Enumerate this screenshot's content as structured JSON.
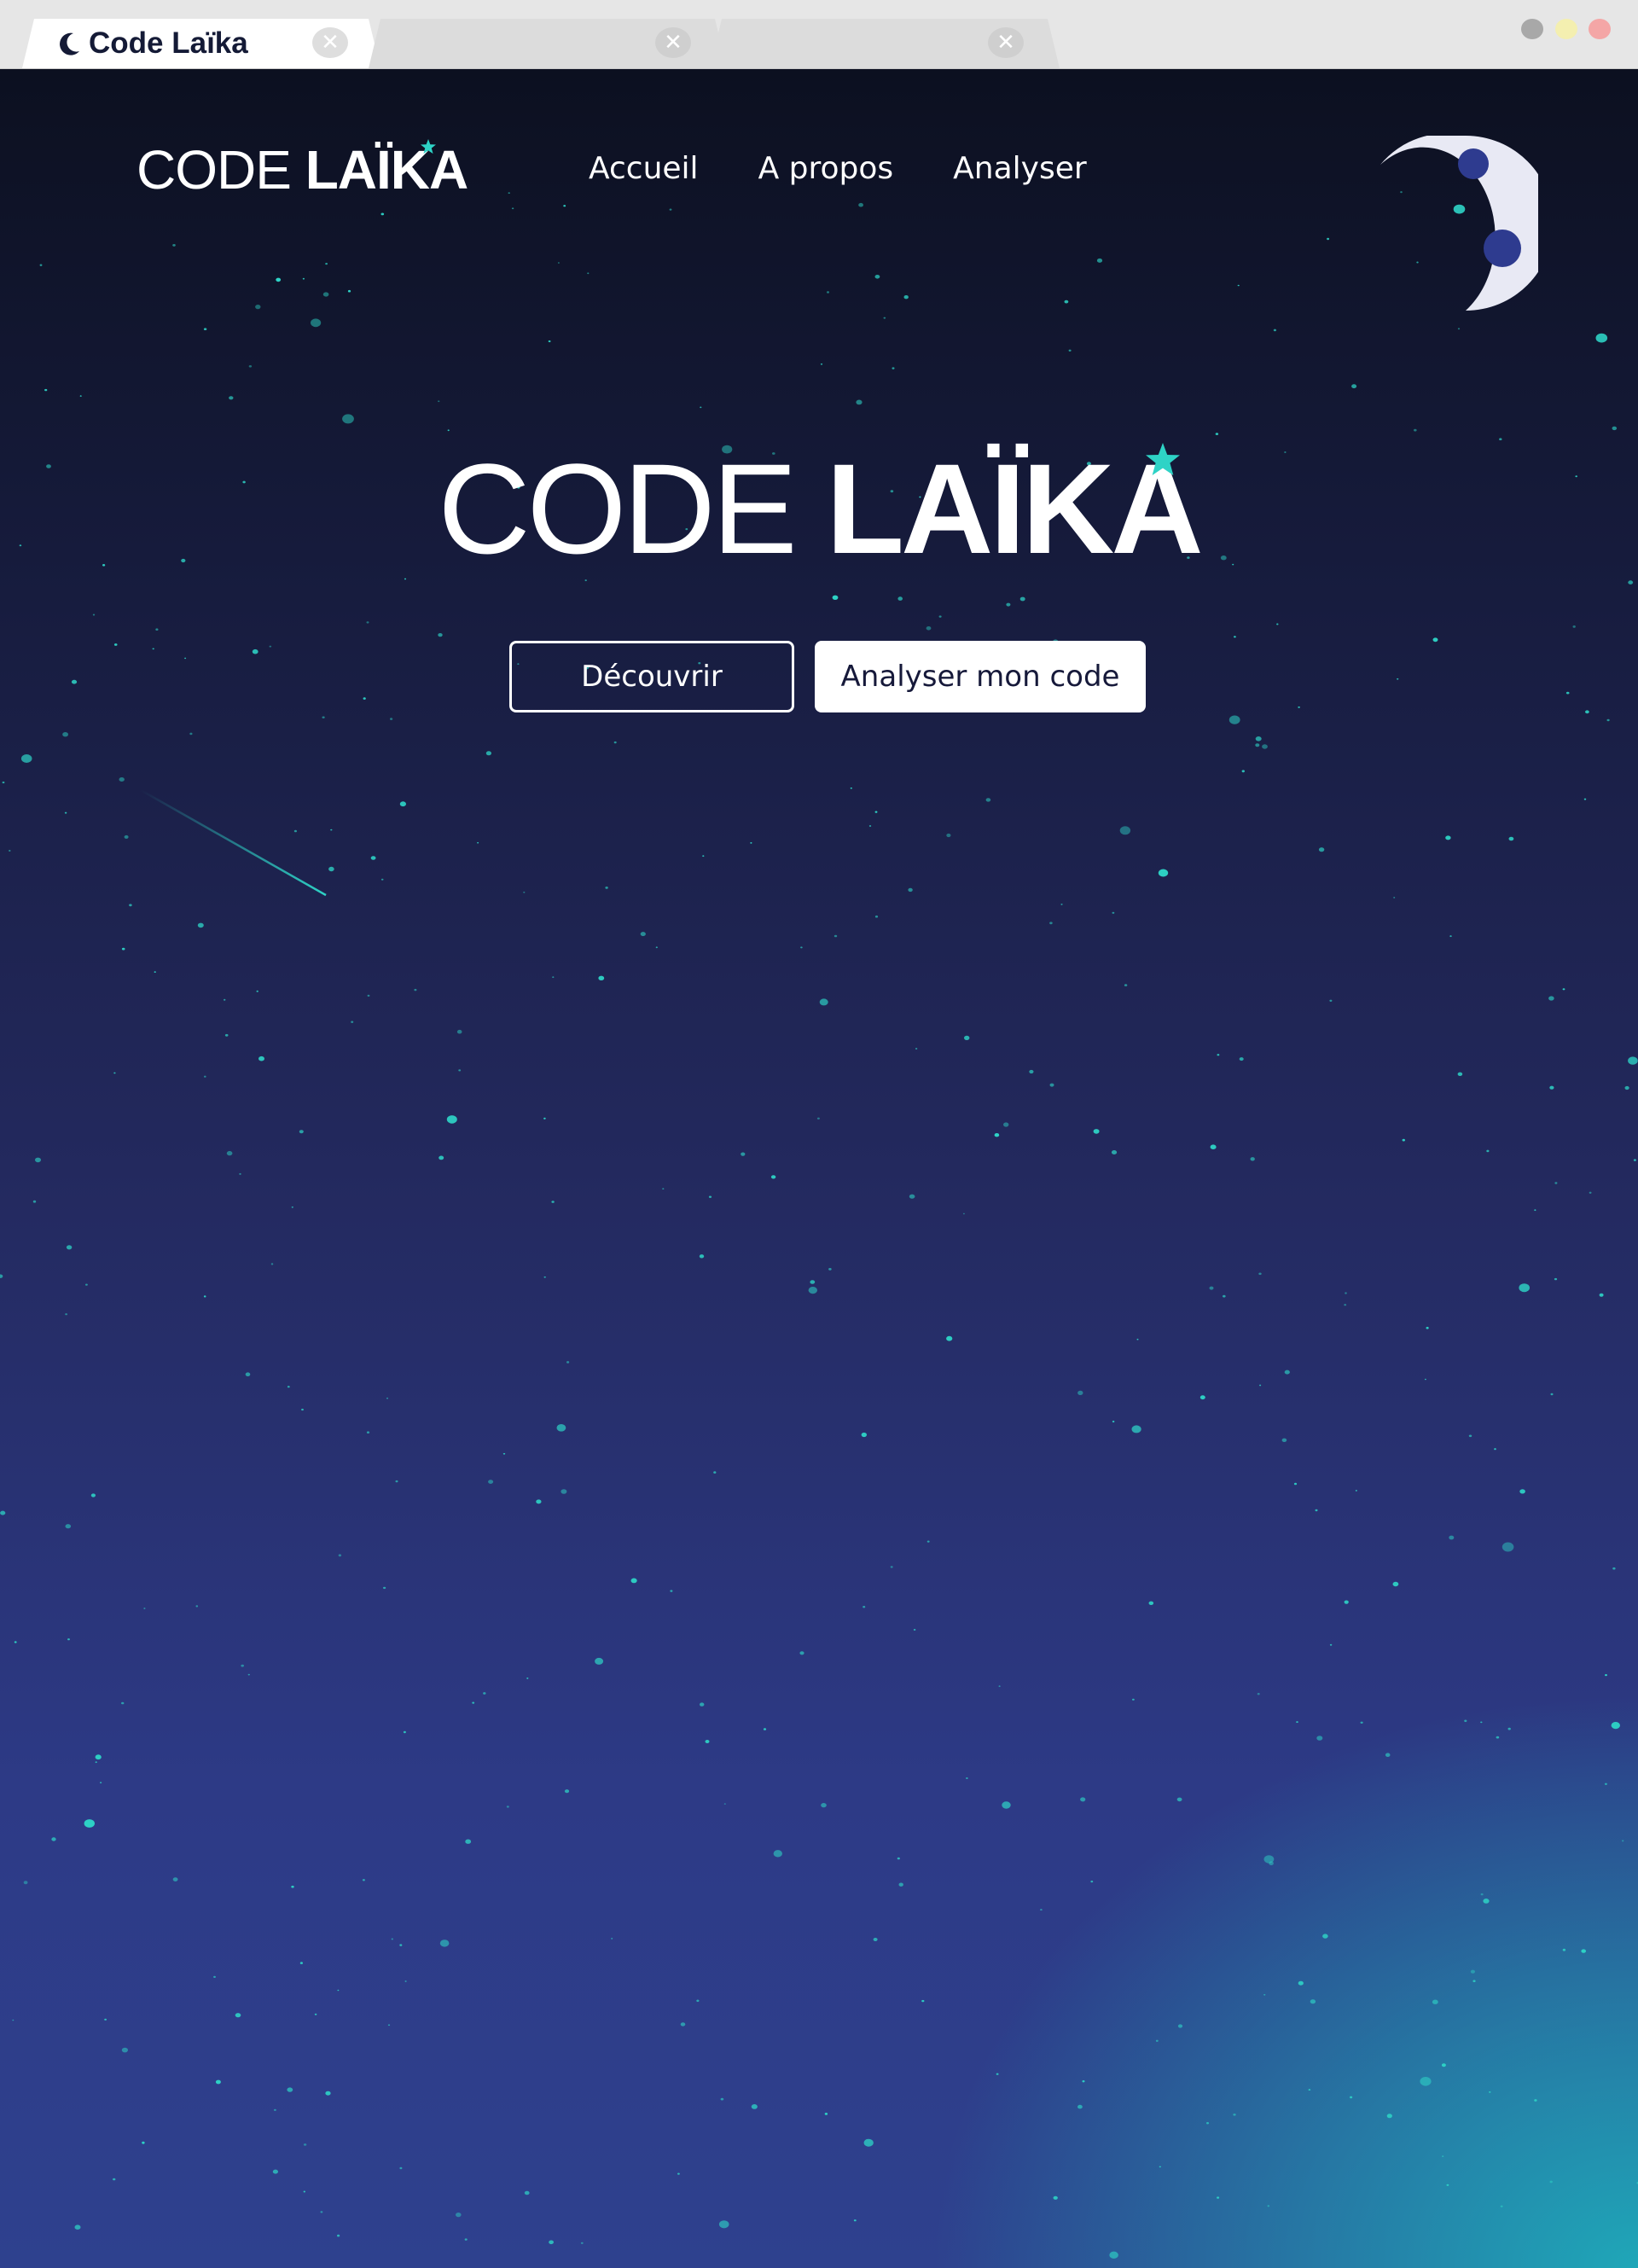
{
  "browser": {
    "tabs": [
      {
        "title": "Code Laïka",
        "active": true,
        "icon": "crescent-moon-icon"
      },
      {
        "title": "",
        "active": false
      },
      {
        "title": "",
        "active": false
      }
    ],
    "close_glyph": "✕",
    "window_controls": [
      {
        "name": "minimize",
        "color": "#a8a8a8"
      },
      {
        "name": "maximize",
        "color": "#f4efb0"
      },
      {
        "name": "close",
        "color": "#f4a6a6"
      }
    ]
  },
  "header": {
    "logo_light": "CODE",
    "logo_bold": "LAÏKA",
    "nav": [
      "Accueil",
      "A propos",
      "Analyser"
    ],
    "theme_icon": "moon-icon"
  },
  "hero": {
    "title_light": "CODE",
    "title_bold": "LAÏKA",
    "buttons": {
      "discover": "Découvrir",
      "analyze": "Analyser mon code"
    }
  },
  "colors": {
    "accent": "#2ed3c6",
    "text": "#ffffff",
    "dark_text": "#16193a",
    "moon": "#e8e9f4",
    "moon_crater": "#2e3b8f"
  }
}
